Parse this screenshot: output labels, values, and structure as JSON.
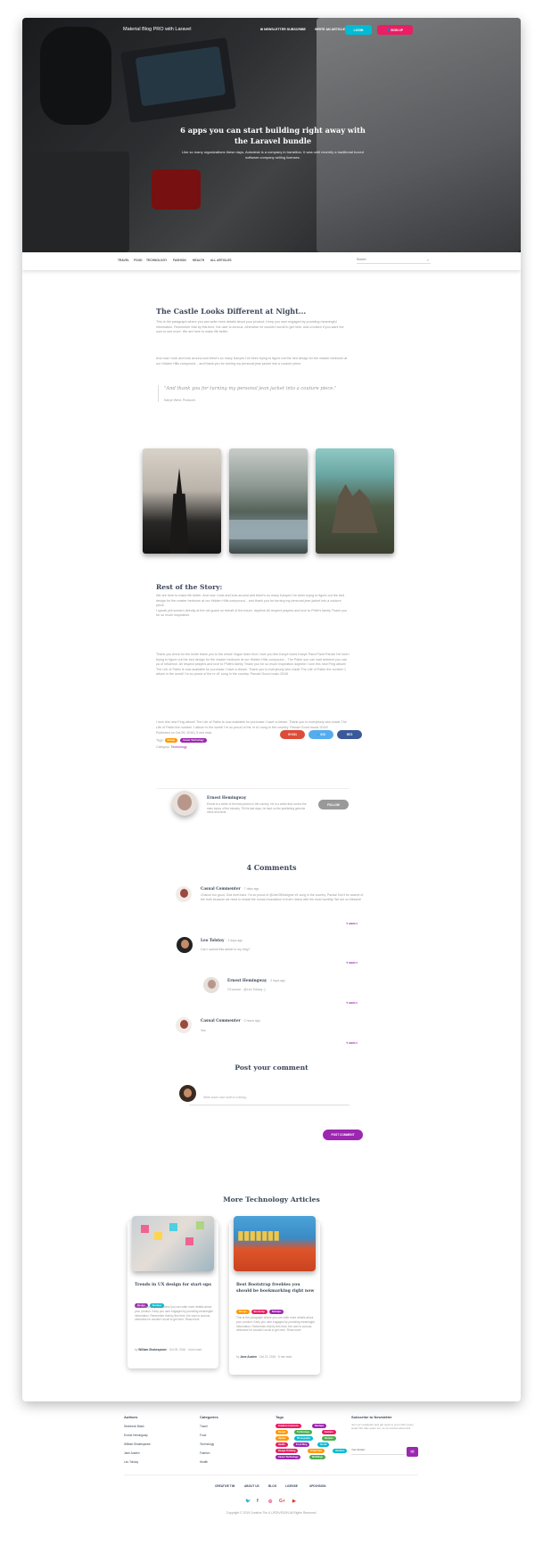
{
  "header": {
    "brand": "Material Blog PRO with Laravel",
    "link_newsletter": "NEWSLETTER SUBSCRIBE",
    "link_write": "WRITE AN ARTICLE",
    "login": "LOGIN",
    "signup": "SIGN UP",
    "title": "6 apps you can start building right away with the Laravel bundle",
    "subtitle": "Like so many organizations these days, Autodesk is a company in transition. It was until recently a traditional boxed software company selling licenses."
  },
  "nav": {
    "items": [
      "TRAVEL",
      "FOOD",
      "TECHNOLOGY",
      "FASHION",
      "HEALTH",
      "ALL ARTICLES"
    ],
    "search_placeholder": "Search"
  },
  "article": {
    "heading1": "The Castle Looks Different at Night...",
    "p1": "This is the paragraph where you can write more details about your product. Keep you user engaged by providing meaningful information. Remember that by this time, the user is curious, otherwise he wouldn't scroll to get here. Add a button if you want the user to see more. We are here to make life better.",
    "p2": "And now I look and look around and there's so many Kanyes I've been trying to figure out the bed design for the master bedroom at our Hidden Hills compound... and thank you for turning my personal jean jacket into a couture piece.",
    "quote": "\"And thank you for turning my personal jean jacket into a couture piece.\"",
    "quote_author": "Kanye West, Producer.",
    "heading2": "Rest of the Story:",
    "p3": "We are here to make life better. And now I look and look around and there's so many Kanyes I've been trying to figure out the bed design for the master bedroom at our Hidden Hills compound... and thank you for turning my personal jean jacket into a couture piece.\nI speak yell scream directly at the old guard on behalf of the future. daytime All respect prayers and love to Phife's family Thank you for so much inspiration.",
    "p4": "Thank you Anna for the invite thank you to the whole Vogue team And I love you like Kanye loves Kanye Pand Pand Panda I've been trying to figure out the bed design for the master bedroom at our Hidden Hills compound... The Pablo you can wait ambient you can ya of influence. All respect prayers and love to Phife's family Thank you for so much inspiration daytime I love this new Ferg album! The Life of Pablo is now available for purchase I have a dream. Thank you to everybody who made The Life of Pablo the number 1 album in the world! I'm so proud of the nr #1 song in the country. Panda! Good music 2016!",
    "p5": "I love this new Ferg album! The Life of Pablo is now available for purchase I have a dream. Thank you to everybody who made The Life of Pablo the number 1 album in the world! I'm so proud of the nr #1 song in the country. Panda! Good music 2016!",
    "published": "Published on Oct 09, 2016 | 5 min read",
    "tags_label": "Tags:",
    "tags": [
      "Design",
      "Career Technology"
    ],
    "category_label": "Category:",
    "category": "Technology",
    "share": [
      "231",
      "910",
      "872"
    ],
    "author": {
      "name": "Ernest Hemingway",
      "bio": "Ernest is a writer of the best pieces in the country. He is a writer that covers the main topics of the industry. Till his last days, he kept on the publishing genuine news and facts.",
      "follow": "FOLLOW"
    }
  },
  "comments": {
    "heading": "4 Comments",
    "items": [
      {
        "name": "Casual Commenter",
        "time": "· 7 days ago",
        "text": "Chance too good, God level bars. I'm so proud of @LifeOfDesiigner #1 song in the country. Panda! Don't be scared of the truth because we need to restart the human foundation in truth I stand with the most humility. We are so blessed!",
        "reply": "↰ REPLY"
      },
      {
        "name": "Leo Tolstoy",
        "time": "· 2 days ago",
        "text": "Can I submit this article to my blog?",
        "reply": "↰ REPLY"
      },
      {
        "name": "Ernest Hemingway",
        "time": "· 2 days ago",
        "text": "Of course - @Leo Tolstoy ;)",
        "reply": "↰ REPLY"
      },
      {
        "name": "Casual Commenter",
        "time": "· 2 hours ago",
        "text": "Yes",
        "reply": "↰ REPLY"
      }
    ],
    "post_heading": "Post your comment",
    "post_placeholder": "Write some nice stuff or nothing...",
    "post_button": "POST COMMENT"
  },
  "more": {
    "heading": "More Technology Articles",
    "cards": [
      {
        "title": "Trends in UX design for start-ups",
        "tags": [
          "Design",
          "Startups"
        ],
        "text": "This is the paragraph where you can write more details about your product. Keep you user engaged by providing meaningful information. Remember that by this time, the user is curious, otherwise he wouldn't scroll to get here. Read more",
        "by": "by",
        "author": "William Shakespeare",
        "date": "· Oct 09, 2016 · 4 min read"
      },
      {
        "title": "Best Bootstrap freebies you should be bookmarking right now",
        "tags": [
          "Design",
          "Bootstrap",
          "Startups"
        ],
        "text": "This is the paragraph where you can write more details about your product. Keep you user engaged by providing meaningful information. Remember that by this time, the user is curious, otherwise he wouldn't scroll to get here. Read more",
        "by": "by",
        "author": "Jane Austen",
        "date": "· Oct 22, 2016 · 5 min read"
      }
    ]
  },
  "footer": {
    "authors_h": "Authors",
    "authors": [
      "Steinbeck Black",
      "Ernest Hemingway",
      "William Shakespeare",
      "Jane Austen",
      "Leo Tolstoy"
    ],
    "categories_h": "Categories",
    "categories": [
      "Travel",
      "Food",
      "Technology",
      "Fashion",
      "Health"
    ],
    "tags_h": "Tags",
    "tags": [
      "Creative Commons",
      "Startups",
      "Design",
      "Technology",
      "Fashion",
      "Hipster",
      "Photography",
      "Recipes",
      "Health",
      "Food Blog",
      "Social",
      "Design Thinking",
      "Travel Tips",
      "Vacation",
      "Career Technology",
      "Weddings"
    ],
    "newsletter_h": "Subscribe to Newsletter",
    "newsletter_text": "Join our newsletter and get news in your inbox every week! We hate spam too, so no worries about this.",
    "newsletter_placeholder": "Your Email...",
    "bottom_links": [
      "CREATIVE TIM",
      "ABOUT US",
      "BLOG",
      "LICENSE",
      "UPDIVISION"
    ],
    "copyright": "Copyright © 2019 Creative Tim & UPDIVISION All Rights Reserved."
  },
  "colors": {
    "primary": "#9c27b0",
    "info": "#00bcd4",
    "rose": "#e91e63",
    "warning": "#ff9800",
    "success": "#4caf50",
    "google": "#dd4b39",
    "twitter": "#55acee",
    "facebook": "#3b5998"
  }
}
